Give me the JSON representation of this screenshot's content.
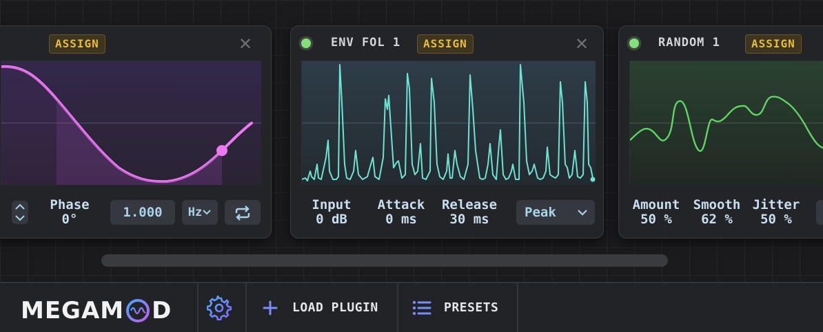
{
  "lfo": {
    "assign_label": "ASSIGN",
    "phase": {
      "label": "Phase",
      "value": "0°"
    },
    "rate_value": "1.000",
    "unit_select": "Hz"
  },
  "env": {
    "title": "ENV FOL 1",
    "assign_label": "ASSIGN",
    "params": [
      {
        "label": "Input",
        "value": "0 dB"
      },
      {
        "label": "Attack",
        "value": "0 ms"
      },
      {
        "label": "Release",
        "value": "30 ms"
      }
    ],
    "mode_select": "Peak"
  },
  "random": {
    "title": "RANDOM 1",
    "assign_label": "ASSIGN",
    "params": [
      {
        "label": "Amount",
        "value": "50 %"
      },
      {
        "label": "Smooth",
        "value": "62 %"
      },
      {
        "label": "Jitter",
        "value": "50 %"
      }
    ]
  },
  "footer": {
    "logo_left": "MEGAM",
    "logo_right": "D",
    "load_plugin_label": "LOAD PLUGIN",
    "presets_label": "PRESETS"
  },
  "icons": {
    "close": "close-icon",
    "power": "power-icon",
    "loop": "loop-icon",
    "gear": "gear-icon",
    "plus": "plus-icon",
    "list": "list-icon"
  },
  "colors": {
    "lfo_curve": "#ec78f2",
    "env_curve": "#6fe3d3",
    "random_curve": "#5fd664",
    "assign_text": "#e9bd39",
    "power_on": "#84e07a"
  }
}
